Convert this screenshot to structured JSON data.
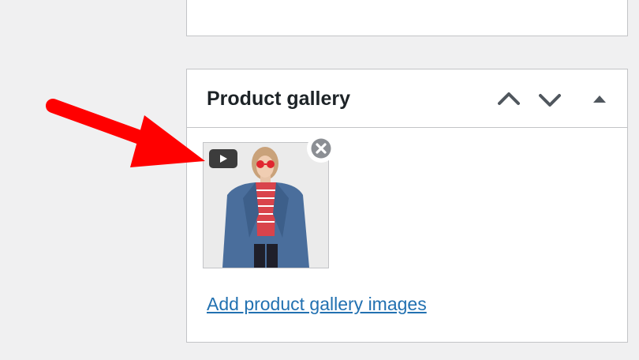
{
  "postbox": {
    "title": "Product gallery",
    "add_link": "Add product gallery images"
  },
  "icons": {
    "move_up": "chevron-up-icon",
    "move_down": "chevron-down-icon",
    "toggle": "triangle-up-icon",
    "video_badge": "play-icon",
    "remove": "close-circle-icon",
    "annotation": "red-arrow"
  },
  "colors": {
    "page_background": "#f0f0f1",
    "panel_border": "#c3c4c7",
    "title_text": "#1d2327",
    "control_icon": "#50575e",
    "link": "#2271b1",
    "annotation_arrow": "#ff0000"
  },
  "gallery": {
    "items": [
      {
        "type": "video",
        "has_video_badge": true
      }
    ]
  }
}
